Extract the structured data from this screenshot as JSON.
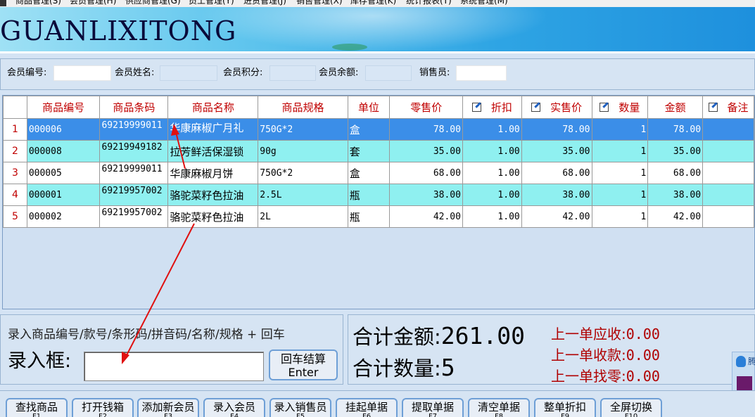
{
  "menu": [
    "商品管理(S)",
    "会员管理(H)",
    "供应商管理(G)",
    "员工管理(Y)",
    "进货管理(J)",
    "销售管理(X)",
    "库存管理(K)",
    "统计报表(T)",
    "系统管理(M)"
  ],
  "banner": {
    "title": "GUANLIXITONG"
  },
  "member": {
    "id_label": "会员编号:",
    "id_value": "",
    "name_label": "会员姓名:",
    "name_value": "",
    "points_label": "会员积分:",
    "points_value": "",
    "balance_label": "会员余额:",
    "balance_value": "",
    "seller_label": "销售员:",
    "seller_value": ""
  },
  "grid": {
    "headers": [
      "商品编号",
      "商品条码",
      "商品名称",
      "商品规格",
      "单位",
      "零售价",
      "折扣",
      "实售价",
      "数量",
      "金额",
      "备注"
    ],
    "rows": [
      {
        "n": "1",
        "code": "000006",
        "barcode": "69219999011",
        "name": "华康麻椒广月礼",
        "spec": "750G*2",
        "unit": "盒",
        "retail": "78.00",
        "discount": "1.00",
        "actual": "78.00",
        "qty": "1",
        "amount": "78.00",
        "note": ""
      },
      {
        "n": "2",
        "code": "000008",
        "barcode": "69219949182",
        "name": "拉芳鲜活保湿锁",
        "spec": "90g",
        "unit": "套",
        "retail": "35.00",
        "discount": "1.00",
        "actual": "35.00",
        "qty": "1",
        "amount": "35.00",
        "note": ""
      },
      {
        "n": "3",
        "code": "000005",
        "barcode": "69219999011",
        "name": "华康麻椒月饼",
        "spec": "750G*2",
        "unit": "盒",
        "retail": "68.00",
        "discount": "1.00",
        "actual": "68.00",
        "qty": "1",
        "amount": "68.00",
        "note": ""
      },
      {
        "n": "4",
        "code": "000001",
        "barcode": "69219957002",
        "name": "骆驼菜籽色拉油",
        "spec": "2.5L",
        "unit": "瓶",
        "retail": "38.00",
        "discount": "1.00",
        "actual": "38.00",
        "qty": "1",
        "amount": "38.00",
        "note": ""
      },
      {
        "n": "5",
        "code": "000002",
        "barcode": "69219957002",
        "name": "骆驼菜籽色拉油",
        "spec": "2L",
        "unit": "瓶",
        "retail": "42.00",
        "discount": "1.00",
        "actual": "42.00",
        "qty": "1",
        "amount": "42.00",
        "note": ""
      }
    ]
  },
  "input": {
    "hint": "录入商品编号/款号/条形码/拼音码/名称/规格 + 回车",
    "label": "录入框:",
    "value": "",
    "enter_line1": "回车结算",
    "enter_line2": "Enter"
  },
  "totals": {
    "amount_label": "合计金额:",
    "amount_value": "261.00",
    "qty_label": "合计数量:",
    "qty_value": "5",
    "last_due_label": "上一单应收:",
    "last_due_value": "0.00",
    "last_paid_label": "上一单收款:",
    "last_paid_value": "0.00",
    "last_change_label": "上一单找零:",
    "last_change_value": "0.00"
  },
  "side_widget": {
    "text": "腾"
  },
  "buttons": [
    {
      "label": "查找商品",
      "key": "F1"
    },
    {
      "label": "打开钱箱",
      "key": "F2"
    },
    {
      "label": "添加新会员",
      "key": "F3"
    },
    {
      "label": "录入会员",
      "key": "F4"
    },
    {
      "label": "录入销售员",
      "key": "F5"
    },
    {
      "label": "挂起单据",
      "key": "F6"
    },
    {
      "label": "提取单据",
      "key": "F7"
    },
    {
      "label": "清空单据",
      "key": "F8"
    },
    {
      "label": "整单折扣",
      "key": "F9"
    },
    {
      "label": "全屏切换",
      "key": "F10"
    }
  ],
  "colors": {
    "header_text": "#c00000",
    "selected_row": "#3b8ee8",
    "alt_row": "#8ff0f0",
    "annotation_arrow": "#e01010"
  }
}
